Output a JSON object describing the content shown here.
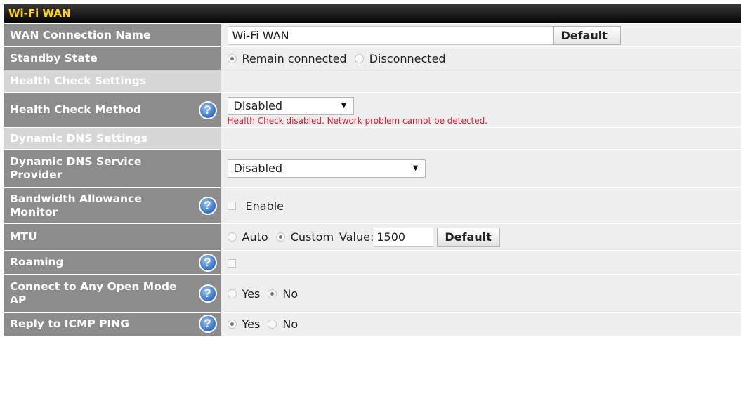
{
  "panel": {
    "title": "Wi-Fi WAN"
  },
  "rows": {
    "connection_name": {
      "label": "WAN Connection Name",
      "value": "Wi-Fi WAN",
      "default_button": "Default"
    },
    "standby_state": {
      "label": "Standby State",
      "option_1": "Remain connected",
      "option_2": "Disconnected",
      "selected": "Remain connected"
    },
    "health_section": {
      "label": "Health Check Settings"
    },
    "health_method": {
      "label": "Health Check Method",
      "selected": "Disabled",
      "warning": "Health Check disabled. Network problem cannot be detected."
    },
    "ddns_section": {
      "label": "Dynamic DNS Settings"
    },
    "ddns_provider": {
      "label": "Dynamic DNS Service Provider",
      "selected": "Disabled"
    },
    "bandwidth": {
      "label": "Bandwidth Allowance Monitor",
      "checkbox_label": "Enable",
      "checked": false
    },
    "mtu": {
      "label": "MTU",
      "option_auto": "Auto",
      "option_custom": "Custom",
      "value_label": "Value:",
      "value": "1500",
      "default_button": "Default",
      "selected": "Custom"
    },
    "roaming": {
      "label": "Roaming",
      "checked": false
    },
    "open_mode": {
      "label": "Connect to Any Open Mode AP",
      "option_yes": "Yes",
      "option_no": "No",
      "selected": "No"
    },
    "icmp_ping": {
      "label": "Reply to ICMP PING",
      "option_yes": "Yes",
      "option_no": "No",
      "selected": "Yes"
    }
  },
  "icons": {
    "help": "help-icon",
    "dropdown": "dropdown-arrow-icon"
  },
  "help_glyph": "?",
  "arrow_glyph": "▼",
  "colors": {
    "title_text": "#ffd21a",
    "label_bg": "#8c8c8c",
    "value_bg": "#eeeeee",
    "warning": "#e01b2e",
    "help": "#2f6fc8"
  }
}
